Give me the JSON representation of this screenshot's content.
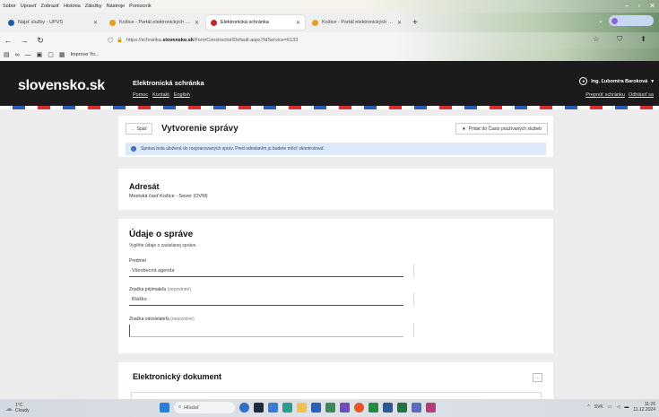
{
  "browser": {
    "menu": [
      "Súbor",
      "Upraviť",
      "Zobraziť",
      "História",
      "Záložky",
      "Nástroje",
      "Pomocník"
    ],
    "tabs": [
      {
        "title": "Nájsť služby - ÚPVS",
        "active": false
      },
      {
        "title": "Košice - Portál elektronických slu...",
        "active": false
      },
      {
        "title": "Elektronická schránka",
        "active": true
      },
      {
        "title": "Košice - Portál elektronických slu...",
        "active": false
      }
    ],
    "url_prefix": "https://schranka.",
    "url_domain": "slovensko.sk",
    "url_path": "/FormConstructor/Default.aspx?IdService=6133",
    "bookmarks": [
      "Improve Yo..."
    ]
  },
  "site": {
    "logo": "slovensko.sk",
    "title": "Elektronická schránka",
    "links": [
      "Pomoc",
      "Kontakt",
      "English"
    ],
    "user_name": "Ing. Ľubomíra Baroková",
    "user_links": [
      "Prepnúť schránku",
      "Odhlásiť sa"
    ]
  },
  "page": {
    "back_label": "← Späť",
    "title": "Vytvorenie správy",
    "favorites_label": "Pridať do Často používaných služieb",
    "info_text": "Správa bola uložená do rozpracovaných správ. Pred odoslaním ju budete môcť skontrolovať.",
    "adresat": {
      "title": "Adresát",
      "value": "Mestská časť Košice - Sever (OVM)"
    },
    "udaje": {
      "title": "Údaje o správe",
      "subtitle": "Vyplňte údaje o zasielanej správe.",
      "fields": [
        {
          "label": "Predmet",
          "optional": "",
          "value": "Všeobecná agenda"
        },
        {
          "label": "Značka prijímateľa",
          "optional": "(nepovinné)",
          "value": "Bláško"
        },
        {
          "label": "Značka odosielateľa",
          "optional": "(nepovinné)",
          "value": ""
        }
      ]
    },
    "document": {
      "title": "Elektronický dokument"
    }
  },
  "taskbar": {
    "weather_temp": "1°C",
    "weather_text": "Cloudy",
    "search_placeholder": "Hľadať",
    "lang": "SVK",
    "time": "11:26",
    "date": "11.12.2024"
  },
  "colors": {
    "header_bg": "#1b1b1b",
    "info_bg": "#dbe9f8",
    "stripe_blue": "#2a5bb5",
    "stripe_red": "#d63232"
  }
}
